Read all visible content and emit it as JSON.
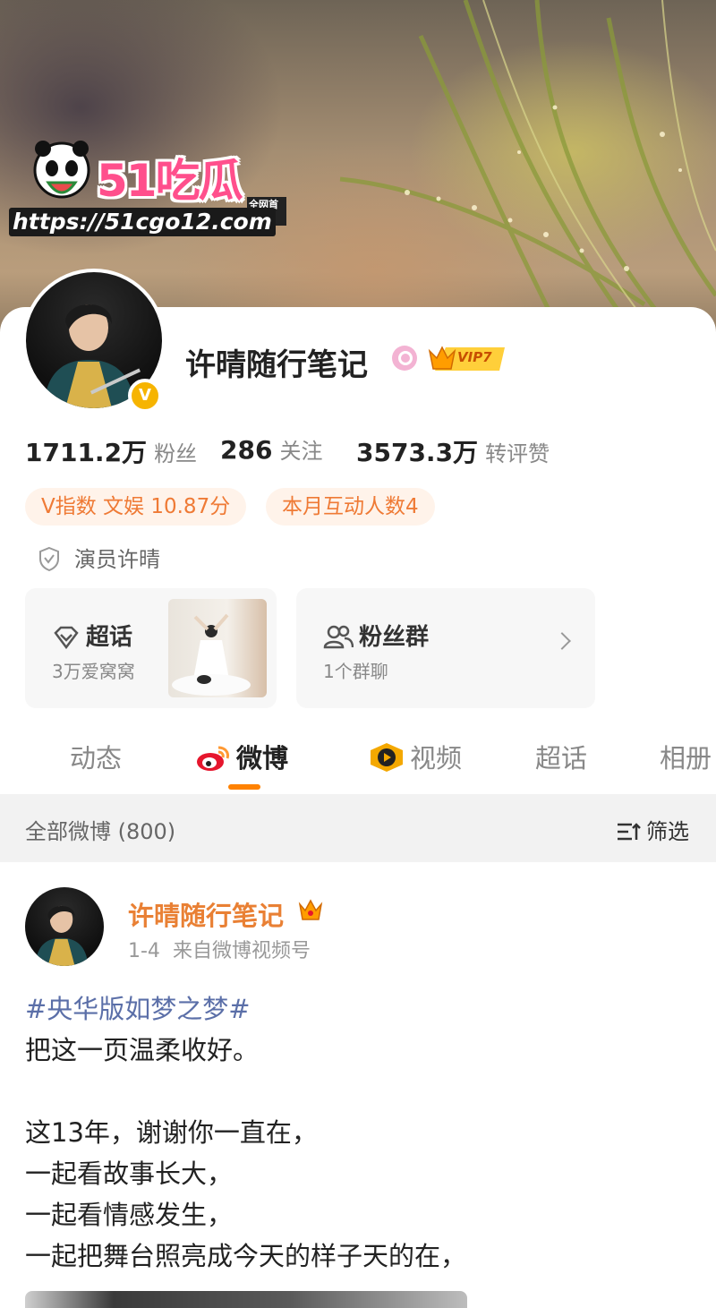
{
  "watermark": {
    "brand": "51吃瓜",
    "tag": "全网首发",
    "url": "https://51cgo12.com"
  },
  "profile": {
    "name": "许晴随行笔记",
    "vip_label": "VIP7",
    "verified_badge": "V",
    "stats": [
      {
        "value": "1711.2万",
        "label": "粉丝"
      },
      {
        "value": "286",
        "label": "关注"
      },
      {
        "value": "3573.3万",
        "label": "转评赞"
      }
    ],
    "tags": [
      "V指数 文娱 10.87分",
      "本月互动人数4"
    ],
    "identity": "演员许晴"
  },
  "cards": {
    "super_topic": {
      "title": "超话",
      "subtitle": "3万爱窝窝"
    },
    "fan_group": {
      "title": "粉丝群",
      "subtitle": "1个群聊"
    }
  },
  "tabs": [
    "动态",
    "微博",
    "视频",
    "超话",
    "相册"
  ],
  "active_tab": "微博",
  "filter": {
    "count_label": "全部微博 (800)",
    "button_label": "筛选"
  },
  "post": {
    "author": "许晴随行笔记",
    "date": "1-4",
    "source": "来自微博视频号",
    "lines": [
      "#央华版如梦之梦#",
      "把这一页温柔收好。",
      "",
      "这13年，谢谢你一直在，",
      "一起看故事长大，",
      "一起看情感发生，",
      "一起把舞台照亮成今天的样子天的在，"
    ]
  },
  "colors": {
    "accent": "#ff8200",
    "orange_text": "#ef7a35",
    "hashtag": "#5b6fa8",
    "name_orange": "#e98034"
  },
  "icons": [
    "panda-icon",
    "pink-search-badge-icon",
    "vip-crown-icon",
    "verified-v-icon",
    "shield-icon",
    "diamond-icon",
    "group-icon",
    "chevron-right-icon",
    "weibo-logo-icon",
    "video-icon",
    "filter-icon",
    "crown-icon"
  ]
}
